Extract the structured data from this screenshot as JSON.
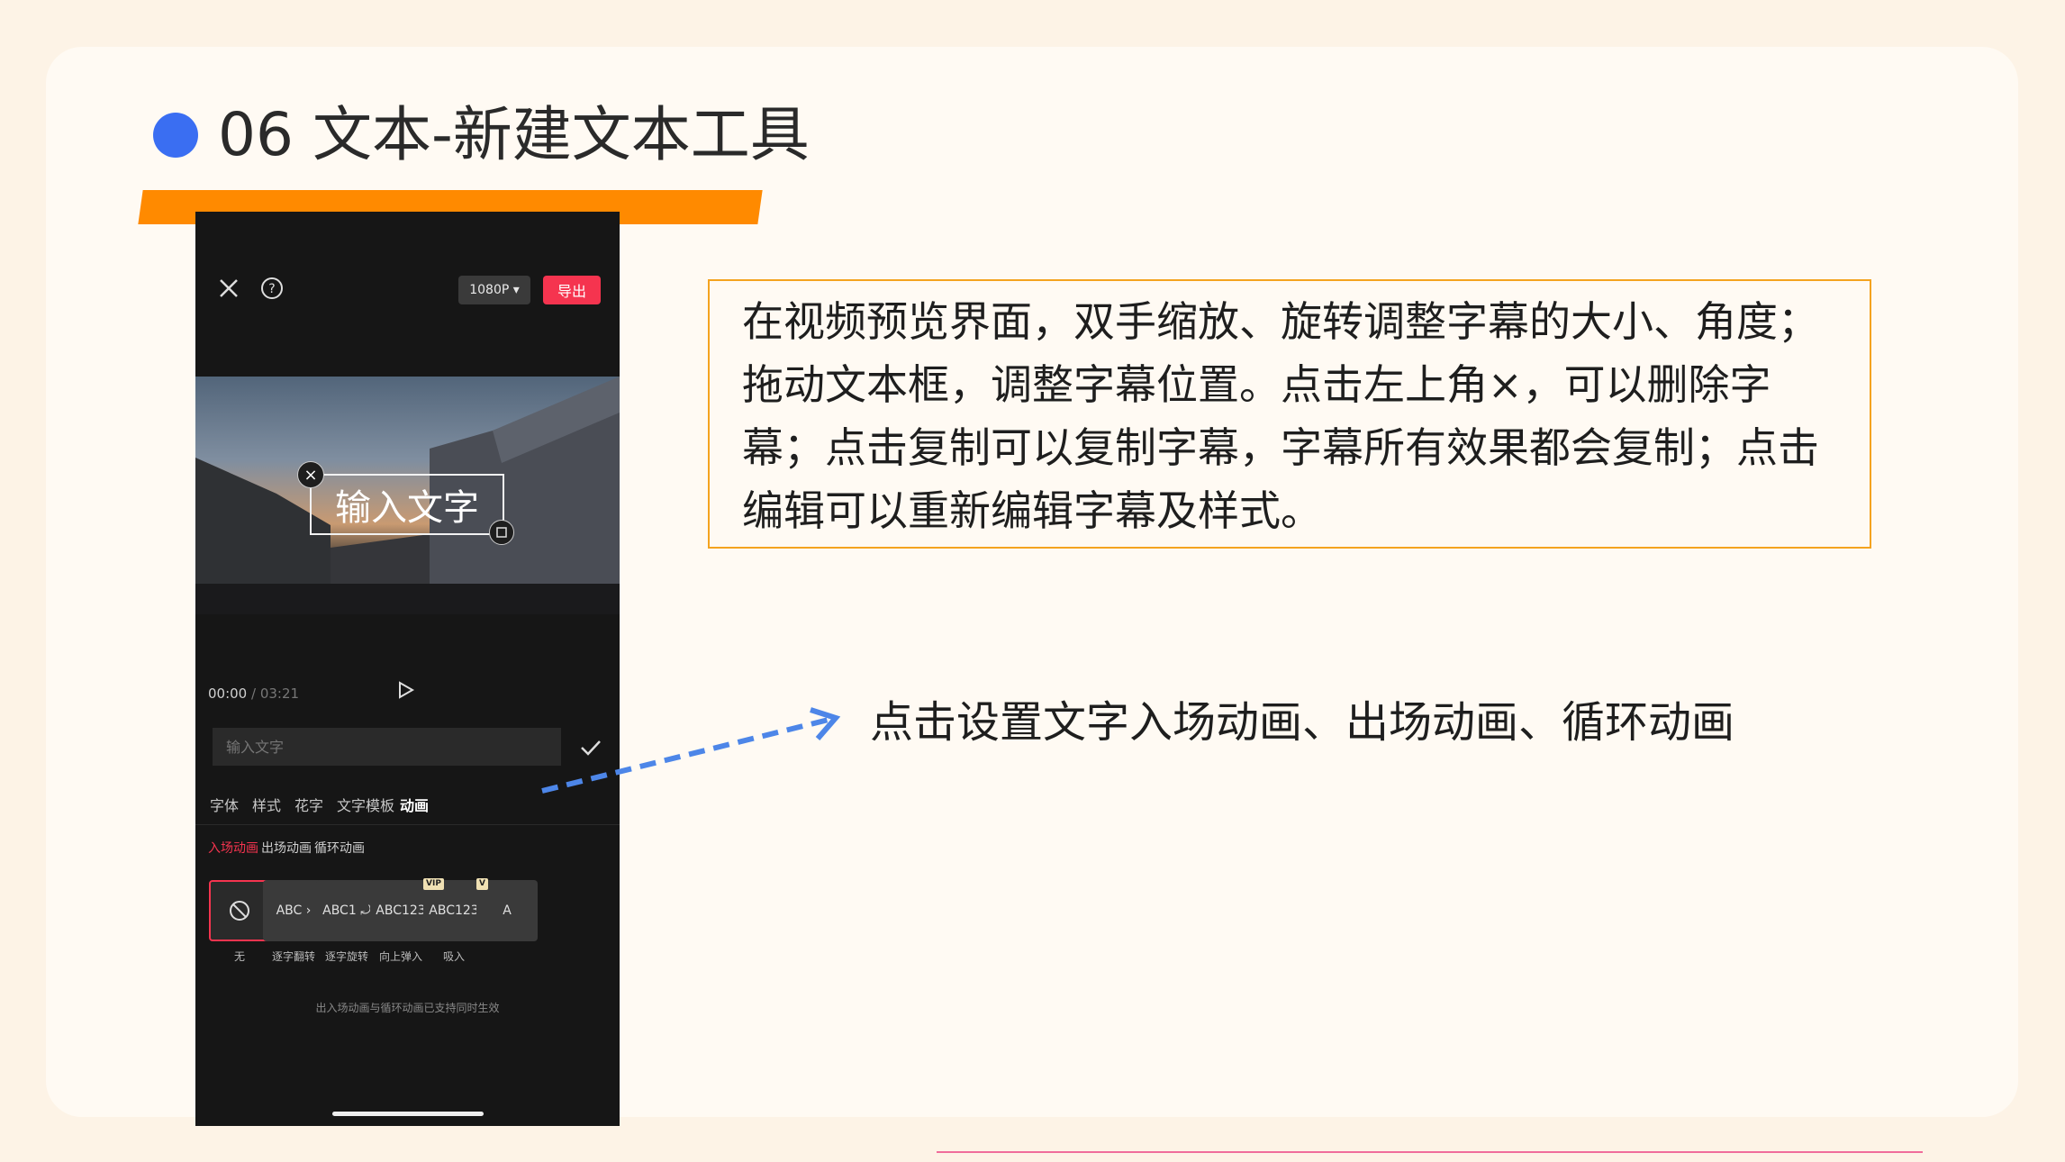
{
  "slide": {
    "title": "06 文本-新建文本工具",
    "description": "在视频预览界面，双手缩放、旋转调整字幕的大小、角度；拖动文本框，调整字幕位置。点击左上角×，可以删除字幕；点击复制可以复制字幕，字幕所有效果都会复制；点击编辑可以重新编辑字幕及样式。",
    "note": "点击设置文字入场动画、出场动画、循环动画",
    "accent_color": "#ff8a00",
    "dot_color": "#3a6ef2"
  },
  "app": {
    "resolution_label": "1080P ▾",
    "export_label": "导出",
    "textbox_text": "输入文字",
    "time_current": "00:00",
    "time_separator": " / ",
    "time_total": "03:21",
    "input_placeholder": "输入文字",
    "tabs": [
      "字体",
      "样式",
      "花字",
      "文字模板",
      "动画"
    ],
    "subtabs": [
      "入场动画",
      "出场动画",
      "循环动画"
    ],
    "animations": [
      {
        "preview": "",
        "label": "无"
      },
      {
        "preview": "ABC ›",
        "label": "逐字翻转"
      },
      {
        "preview": "ABC1 ⤾",
        "label": "逐字旋转"
      },
      {
        "preview": "ABC123",
        "label": "向上弹入"
      },
      {
        "preview": "ABC123",
        "label": "吸入",
        "badge": "VIP"
      },
      {
        "preview": "A",
        "label": "",
        "badge": "V"
      }
    ],
    "hint": "出入场动画与循环动画已支持同时生效",
    "highlight_color": "#f5344f"
  }
}
